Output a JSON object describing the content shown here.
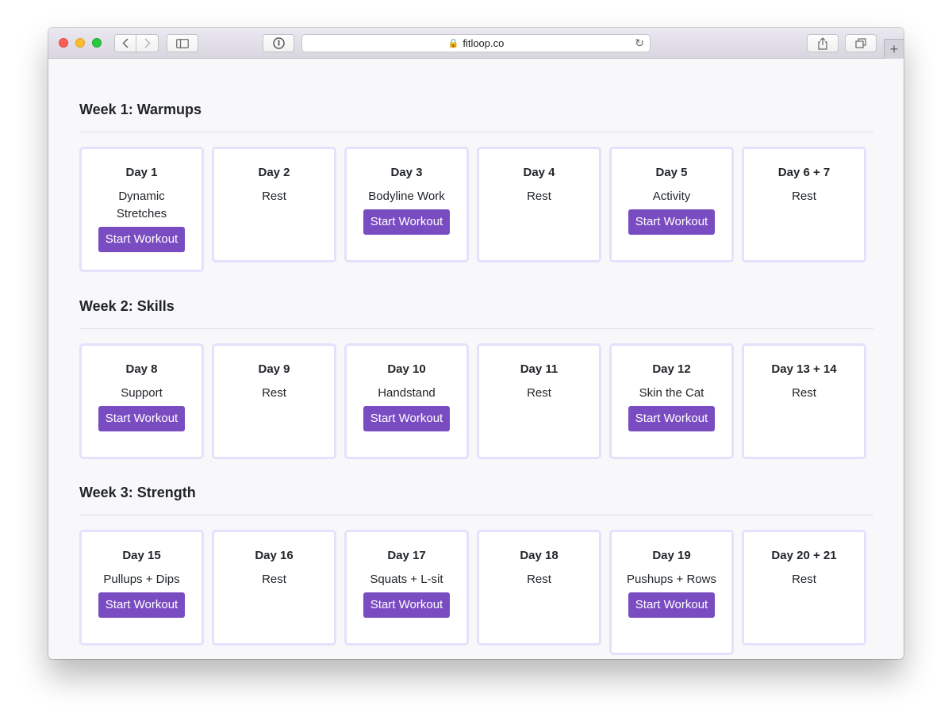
{
  "browser": {
    "url": "fitloop.co"
  },
  "weeks": [
    {
      "title": "Week 1: Warmups",
      "days": [
        {
          "day": "Day 1",
          "activity": "Dynamic Stretches",
          "button": "Start Workout"
        },
        {
          "day": "Day 2",
          "activity": "Rest",
          "button": ""
        },
        {
          "day": "Day 3",
          "activity": "Bodyline Work",
          "button": "Start Workout"
        },
        {
          "day": "Day 4",
          "activity": "Rest",
          "button": ""
        },
        {
          "day": "Day 5",
          "activity": "Activity",
          "button": "Start Workout"
        },
        {
          "day": "Day 6 + 7",
          "activity": "Rest",
          "button": ""
        }
      ]
    },
    {
      "title": "Week 2: Skills",
      "days": [
        {
          "day": "Day 8",
          "activity": "Support",
          "button": "Start Workout"
        },
        {
          "day": "Day 9",
          "activity": "Rest",
          "button": ""
        },
        {
          "day": "Day 10",
          "activity": "Handstand",
          "button": "Start Workout"
        },
        {
          "day": "Day 11",
          "activity": "Rest",
          "button": ""
        },
        {
          "day": "Day 12",
          "activity": "Skin the Cat",
          "button": "Start Workout"
        },
        {
          "day": "Day 13 + 14",
          "activity": "Rest",
          "button": ""
        }
      ]
    },
    {
      "title": "Week 3: Strength",
      "days": [
        {
          "day": "Day 15",
          "activity": "Pullups + Dips",
          "button": "Start Workout"
        },
        {
          "day": "Day 16",
          "activity": "Rest",
          "button": ""
        },
        {
          "day": "Day 17",
          "activity": "Squats + L-sit",
          "button": "Start Workout"
        },
        {
          "day": "Day 18",
          "activity": "Rest",
          "button": ""
        },
        {
          "day": "Day 19",
          "activity": "Pushups + Rows",
          "button": "Start Workout"
        },
        {
          "day": "Day 20 + 21",
          "activity": "Rest",
          "button": ""
        }
      ]
    }
  ],
  "colors": {
    "button": "#7a4cc2",
    "card_border": "#e5e0fb",
    "page_bg": "#f8f8fb"
  }
}
